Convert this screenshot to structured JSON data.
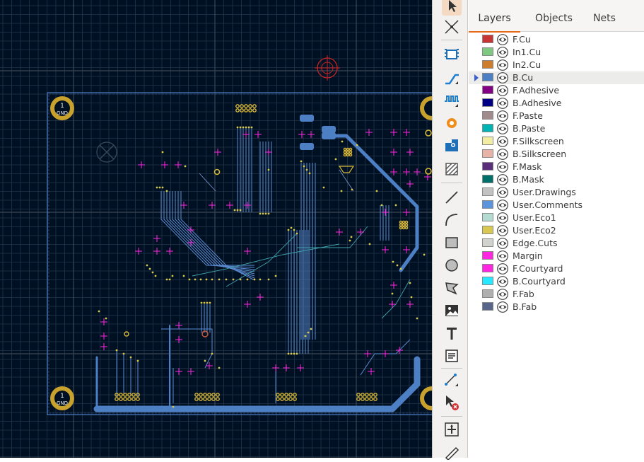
{
  "canvas": {
    "pads": [
      {
        "label": "1",
        "sub": "GND"
      },
      {
        "label": "1",
        "sub": "GND"
      }
    ]
  },
  "toolbar": {
    "tools": [
      {
        "icon": "select-arrow-icon",
        "active": true
      },
      {
        "icon": "local-ratsnest-icon"
      },
      {
        "icon": "add-footprint-icon"
      },
      {
        "icon": "route-track-icon"
      },
      {
        "icon": "tune-length-icon"
      },
      {
        "icon": "add-via-icon"
      },
      {
        "icon": "add-zone-icon"
      },
      {
        "icon": "add-rule-area-icon"
      },
      {
        "icon": "draw-line-icon"
      },
      {
        "icon": "draw-arc-icon"
      },
      {
        "icon": "draw-rectangle-icon"
      },
      {
        "icon": "draw-circle-icon"
      },
      {
        "icon": "draw-polygon-icon"
      },
      {
        "icon": "add-image-icon"
      },
      {
        "icon": "add-text-icon"
      },
      {
        "icon": "add-textbox-icon"
      },
      {
        "icon": "add-dimension-icon"
      },
      {
        "icon": "delete-tool-icon"
      },
      {
        "icon": "set-origin-icon"
      },
      {
        "icon": "measure-icon"
      }
    ]
  },
  "panel": {
    "tabs": [
      {
        "label": "Layers",
        "active": true
      },
      {
        "label": "Objects"
      },
      {
        "label": "Nets"
      }
    ],
    "layers": [
      {
        "name": "F.Cu",
        "color": "#c83434"
      },
      {
        "name": "In1.Cu",
        "color": "#7fc87f"
      },
      {
        "name": "In2.Cu",
        "color": "#ce7d2c"
      },
      {
        "name": "B.Cu",
        "color": "#4d7fc4",
        "selected": true
      },
      {
        "name": "F.Adhesive",
        "color": "#840084"
      },
      {
        "name": "B.Adhesive",
        "color": "#000084"
      },
      {
        "name": "F.Paste",
        "color": "#a08c8c"
      },
      {
        "name": "B.Paste",
        "color": "#00b4b4"
      },
      {
        "name": "F.Silkscreen",
        "color": "#f2eda1"
      },
      {
        "name": "B.Silkscreen",
        "color": "#e8b2a7"
      },
      {
        "name": "F.Mask",
        "color": "#5a2e7a"
      },
      {
        "name": "B.Mask",
        "color": "#02706a"
      },
      {
        "name": "User.Drawings",
        "color": "#c2c2c2"
      },
      {
        "name": "User.Comments",
        "color": "#5994dc"
      },
      {
        "name": "User.Eco1",
        "color": "#b4dbd2"
      },
      {
        "name": "User.Eco2",
        "color": "#d8c852"
      },
      {
        "name": "Edge.Cuts",
        "color": "#d0d2cd"
      },
      {
        "name": "Margin",
        "color": "#ff26e2"
      },
      {
        "name": "F.Courtyard",
        "color": "#ff26e2"
      },
      {
        "name": "B.Courtyard",
        "color": "#26e9ff"
      },
      {
        "name": "F.Fab",
        "color": "#afafaf"
      },
      {
        "name": "B.Fab",
        "color": "#58668c"
      }
    ]
  }
}
